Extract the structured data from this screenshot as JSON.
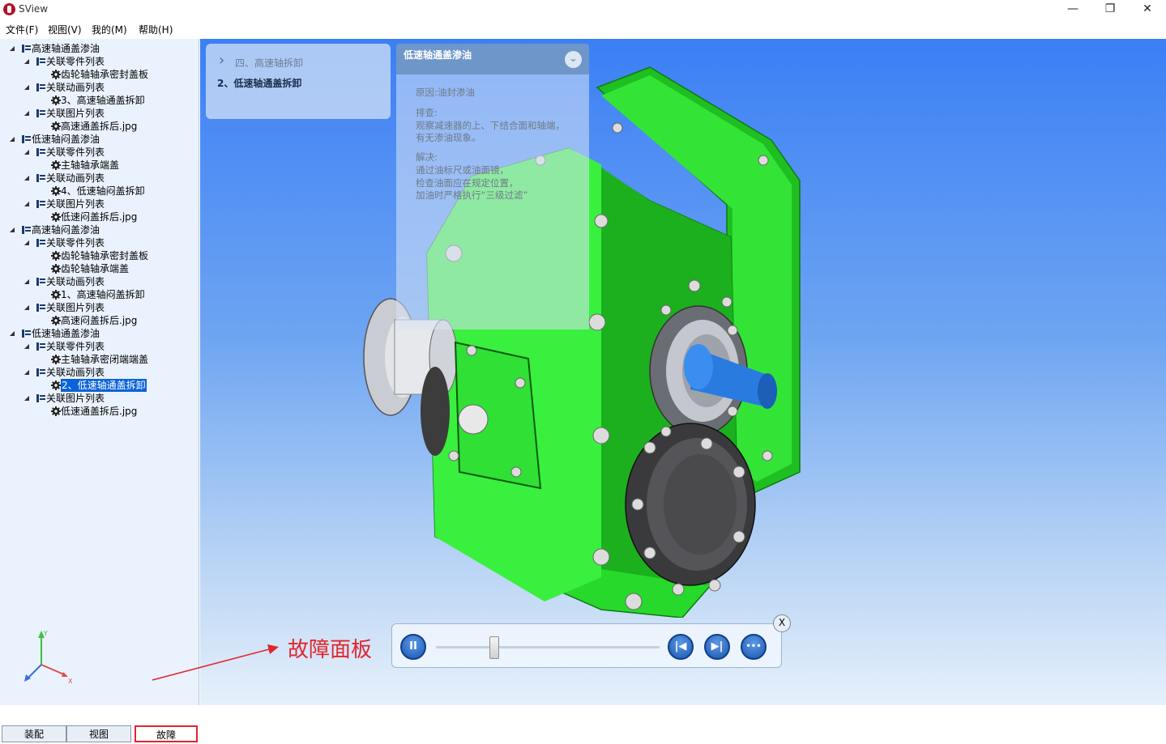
{
  "app": {
    "title": "SView"
  },
  "window_controls": {
    "minimize": "—",
    "restore": "❐",
    "close": "✕"
  },
  "menu": [
    "文件(F)",
    "视图(V)",
    "我的(M)",
    "帮助(H)"
  ],
  "tree": [
    {
      "level": 0,
      "label": "高速轴通盖渗油",
      "icon": "list-icon"
    },
    {
      "level": 1,
      "label": "关联零件列表",
      "icon": "list-icon"
    },
    {
      "level": 2,
      "label": "齿轮轴轴承密封盖板",
      "icon": "gear-icon"
    },
    {
      "level": 1,
      "label": "关联动画列表",
      "icon": "list-icon"
    },
    {
      "level": 2,
      "label": "3、高速轴通盖拆卸",
      "icon": "gear-icon"
    },
    {
      "level": 1,
      "label": "关联图片列表",
      "icon": "list-icon"
    },
    {
      "level": 2,
      "label": "高速通盖拆后.jpg",
      "icon": "gear-icon"
    },
    {
      "level": 0,
      "label": "低速轴闷盖渗油",
      "icon": "list-icon"
    },
    {
      "level": 1,
      "label": "关联零件列表",
      "icon": "list-icon"
    },
    {
      "level": 2,
      "label": "主轴轴承端盖",
      "icon": "gear-icon"
    },
    {
      "level": 1,
      "label": "关联动画列表",
      "icon": "list-icon"
    },
    {
      "level": 2,
      "label": "4、低速轴闷盖拆卸",
      "icon": "gear-icon"
    },
    {
      "level": 1,
      "label": "关联图片列表",
      "icon": "list-icon"
    },
    {
      "level": 2,
      "label": "低速闷盖拆后.jpg",
      "icon": "gear-icon"
    },
    {
      "level": 0,
      "label": "高速轴闷盖渗油",
      "icon": "list-icon"
    },
    {
      "level": 1,
      "label": "关联零件列表",
      "icon": "list-icon"
    },
    {
      "level": 2,
      "label": "齿轮轴轴承密封盖板",
      "icon": "gear-icon"
    },
    {
      "level": 2,
      "label": "齿轮轴轴承端盖",
      "icon": "gear-icon"
    },
    {
      "level": 1,
      "label": "关联动画列表",
      "icon": "list-icon"
    },
    {
      "level": 2,
      "label": "1、高速轴闷盖拆卸",
      "icon": "gear-icon"
    },
    {
      "level": 1,
      "label": "关联图片列表",
      "icon": "list-icon"
    },
    {
      "level": 2,
      "label": "高速闷盖拆后.jpg",
      "icon": "gear-icon"
    },
    {
      "level": 0,
      "label": "低速轴通盖渗油",
      "icon": "list-icon"
    },
    {
      "level": 1,
      "label": "关联零件列表",
      "icon": "list-icon"
    },
    {
      "level": 2,
      "label": "主轴轴承密闭端端盖",
      "icon": "gear-icon"
    },
    {
      "level": 1,
      "label": "关联动画列表",
      "icon": "list-icon"
    },
    {
      "level": 2,
      "label": "2、低速轴通盖拆卸",
      "icon": "gear-icon",
      "selected": true
    },
    {
      "level": 1,
      "label": "关联图片列表",
      "icon": "list-icon"
    },
    {
      "level": 2,
      "label": "低速通盖拆后.jpg",
      "icon": "gear-icon"
    }
  ],
  "bottom_tabs": [
    "装配",
    "视图",
    "故障"
  ],
  "active_tab": "故障",
  "breadcrumb": {
    "parent": "四、高速轴拆卸",
    "current": "2、低速轴通盖拆卸"
  },
  "fault_panel": {
    "title": "低速轴通盖渗油",
    "lines": [
      "原因:油封渗油",
      "",
      "排查:",
      "观察减速器的上、下结合面和轴端，",
      "有无渗油现象。",
      "",
      "解决:",
      "通过油标尺或油面镜，",
      "检查油面应在规定位置，",
      "加油时严格执行“三级过滤”"
    ]
  },
  "player": {
    "pause": "II",
    "prev": "|◀",
    "next": "▶|",
    "more": "•••",
    "close": "X",
    "progress": 0.26
  },
  "annotation": {
    "label": "故障面板"
  },
  "colors": {
    "accent": "#0a63d8",
    "highlight": "#e0262b",
    "model_green": "#2ee833",
    "shaft_blue": "#2a7be0"
  }
}
